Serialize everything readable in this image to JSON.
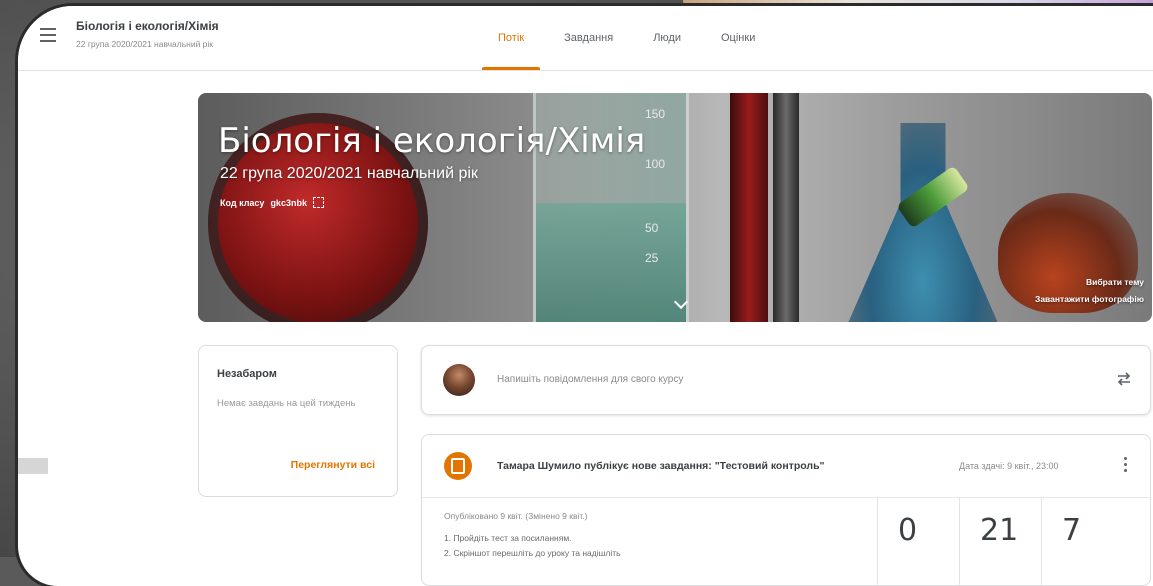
{
  "header": {
    "class_title": "Біологія і екологія/Хімія",
    "class_subtitle": "22 група 2020/2021 навчальний рік",
    "tabs": [
      {
        "label": "Потік",
        "active": true
      },
      {
        "label": "Завдання",
        "active": false
      },
      {
        "label": "Люди",
        "active": false
      },
      {
        "label": "Оцінки",
        "active": false
      }
    ]
  },
  "banner": {
    "title": "Біологія і екологія/Хімія",
    "subtitle": "22 група 2020/2021 навчальний рік",
    "class_code_label": "Код класу",
    "class_code": "gkc3nbk",
    "scale_marks": [
      "150",
      "100",
      "50",
      "25"
    ],
    "select_theme": "Вибрати тему",
    "upload_photo": "Завантажити фотографію"
  },
  "upcoming": {
    "title": "Незабаром",
    "empty_text": "Немає завдань на цей тиждень",
    "view_all": "Переглянути всі"
  },
  "post": {
    "placeholder": "Напишіть повідомлення для свого курсу"
  },
  "assignment": {
    "text": "Тамара Шумило публікує нове завдання: \"Тестовий контроль\"",
    "due": "Дата здачі: 9 квіт., 23:00",
    "published": "Опубліковано 9 квіт. (Змінено 9 квіт.)",
    "line1": "1. Пройдіть тест за посиланням.",
    "line2": "2. Скріншот перешліть до уроку та надішліть",
    "stats": [
      "0",
      "21",
      "7"
    ]
  },
  "colors": {
    "accent": "#e37400",
    "text": "#3c4043",
    "muted": "#8a8a8a"
  }
}
